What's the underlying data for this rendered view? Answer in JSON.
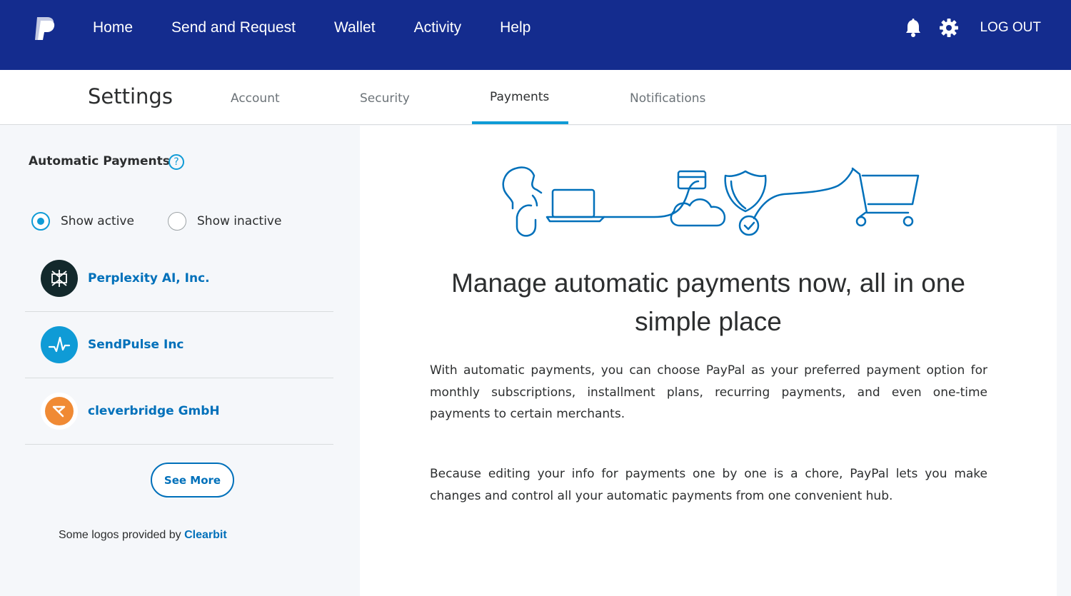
{
  "brand": {
    "logo_icon": "paypal-logo-icon",
    "nav_bg": "#142c8e",
    "accent": "#0f9bd6",
    "link": "#0070ba"
  },
  "topnav": {
    "links": [
      "Home",
      "Send and Request",
      "Wallet",
      "Activity",
      "Help"
    ],
    "icons": [
      "bell-icon",
      "gear-icon"
    ],
    "logout": "LOG OUT"
  },
  "settings": {
    "title": "Settings",
    "tabs": [
      "Account",
      "Security",
      "Payments",
      "Notifications"
    ],
    "active_tab": "Payments"
  },
  "sidebar": {
    "title": "Automatic Payments",
    "help_glyph": "?",
    "filters": [
      {
        "label": "Show active",
        "checked": true
      },
      {
        "label": "Show inactive",
        "checked": false
      }
    ],
    "merchants": [
      {
        "name": "Perplexity AI, Inc.",
        "logo_icon": "perplexity-logo-icon",
        "color": "#13292c"
      },
      {
        "name": "SendPulse Inc",
        "logo_icon": "sendpulse-logo-icon",
        "color": "#0f9bd6"
      },
      {
        "name": "cleverbridge GmbH",
        "logo_icon": "cleverbridge-logo-icon",
        "color": "#f08a34"
      }
    ],
    "see_more": "See More",
    "logos_note_prefix": "Some logos provided by ",
    "logos_note_link": "Clearbit"
  },
  "main": {
    "illustration_icon": "payments-journey-illustration",
    "headline": "Manage automatic payments now, all in one simple place",
    "paragraph1": "With automatic payments, you can choose PayPal as your preferred payment option for monthly subscriptions, installment plans, recurring payments, and even one-time payments to certain merchants.",
    "paragraph2": "Because editing your info for payments one by one is a chore, PayPal lets you make changes and control all your automatic payments from one convenient hub."
  }
}
